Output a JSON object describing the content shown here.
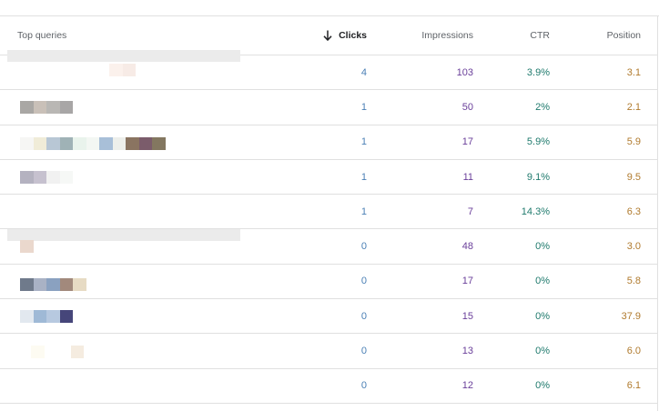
{
  "table": {
    "headers": {
      "query": "Top queries",
      "clicks": "Clicks",
      "impressions": "Impressions",
      "ctr": "CTR",
      "position": "Position"
    },
    "sort_icon": "arrow-down-icon",
    "rows": [
      {
        "clicks": "4",
        "impressions": "103",
        "ctr": "3.9%",
        "position": "3.1"
      },
      {
        "clicks": "1",
        "impressions": "50",
        "ctr": "2%",
        "position": "2.1"
      },
      {
        "clicks": "1",
        "impressions": "17",
        "ctr": "5.9%",
        "position": "5.9"
      },
      {
        "clicks": "1",
        "impressions": "11",
        "ctr": "9.1%",
        "position": "9.5"
      },
      {
        "clicks": "1",
        "impressions": "7",
        "ctr": "14.3%",
        "position": "6.3"
      },
      {
        "clicks": "0",
        "impressions": "48",
        "ctr": "0%",
        "position": "3.0"
      },
      {
        "clicks": "0",
        "impressions": "17",
        "ctr": "0%",
        "position": "5.8"
      },
      {
        "clicks": "0",
        "impressions": "15",
        "ctr": "0%",
        "position": "37.9"
      },
      {
        "clicks": "0",
        "impressions": "13",
        "ctr": "0%",
        "position": "6.0"
      },
      {
        "clicks": "0",
        "impressions": "12",
        "ctr": "0%",
        "position": "6.1"
      }
    ]
  },
  "colors": {
    "clicks": "#4a7fb5",
    "impressions": "#6a3f9a",
    "ctr": "#1f7a6d",
    "position": "#b07a2d",
    "divider": "#e0e0e0"
  }
}
